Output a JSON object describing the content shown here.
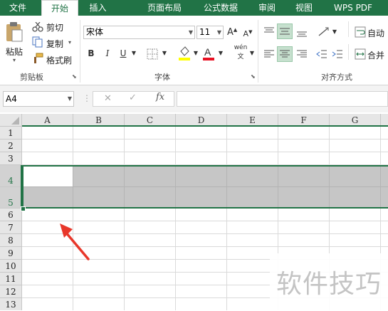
{
  "tabs": [
    {
      "label": "文件"
    },
    {
      "label": "开始"
    },
    {
      "label": "插入"
    },
    {
      "label": "页面布局"
    },
    {
      "label": "公式"
    },
    {
      "label": "数据"
    },
    {
      "label": "审阅"
    },
    {
      "label": "视图"
    },
    {
      "label": "WPS PDF"
    }
  ],
  "clipboard": {
    "paste": "粘贴",
    "cut": "剪切",
    "copy": "复制",
    "format_painter": "格式刷",
    "group_label": "剪贴板"
  },
  "font": {
    "name": "宋体",
    "size": "11",
    "bold": "B",
    "italic": "I",
    "underline": "U",
    "phonetic": "wén",
    "phonetic_char": "文",
    "group_label": "字体"
  },
  "alignment": {
    "wrap": "自动",
    "merge": "合并",
    "group_label": "对齐方式"
  },
  "namebox": {
    "value": "A4"
  },
  "formula": {
    "fx": "fx"
  },
  "columns": [
    "A",
    "B",
    "C",
    "D",
    "E",
    "F",
    "G"
  ],
  "rows": [
    "1",
    "2",
    "3",
    "4",
    "5",
    "6",
    "7",
    "8",
    "9",
    "10",
    "11",
    "12",
    "13"
  ],
  "watermark": "软件技巧",
  "colors": {
    "excel_green": "#217346",
    "selection_gray": "#c6c6c6",
    "arrow_red": "#e8372a",
    "font_highlight_yellow": "#ffff00",
    "font_color_red": "#e81123"
  }
}
